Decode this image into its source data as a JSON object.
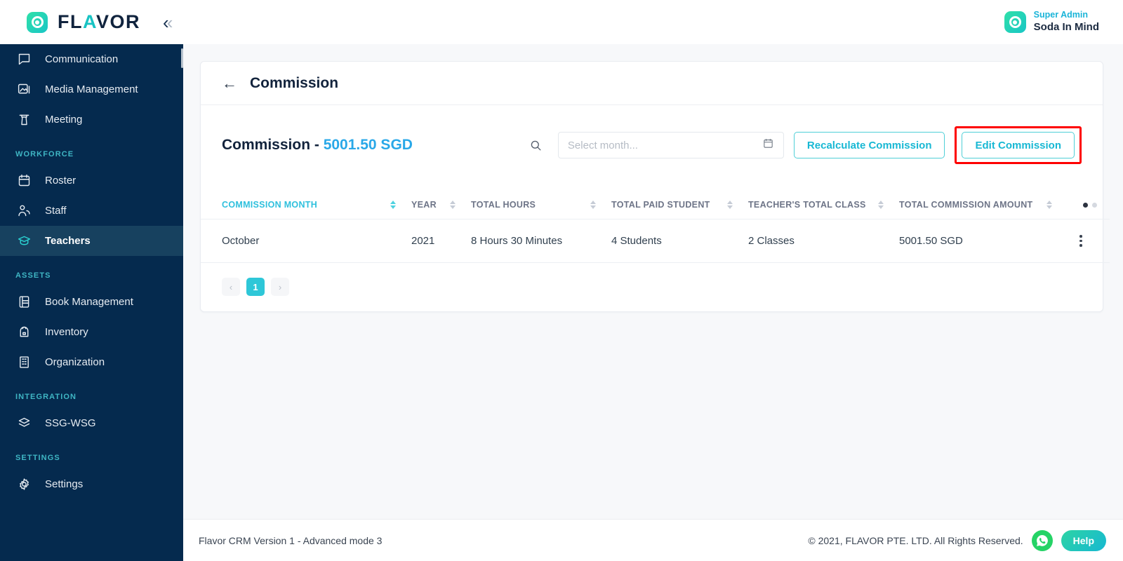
{
  "brand": {
    "name_prefix": "FL",
    "name_accent": "A",
    "name_suffix": "VOR",
    "full": "FLAVOR",
    "collapse_label": "«"
  },
  "user": {
    "role": "Super Admin",
    "name": "Soda In Mind"
  },
  "sidebar": {
    "items": [
      {
        "label": "Communication",
        "icon": "chat-icon",
        "active": false
      },
      {
        "label": "Media Management",
        "icon": "image-icon",
        "active": false
      },
      {
        "label": "Meeting",
        "icon": "podium-icon",
        "active": false
      }
    ],
    "groups": [
      {
        "title": "WORKFORCE",
        "items": [
          {
            "label": "Roster",
            "icon": "calendar-icon",
            "active": false
          },
          {
            "label": "Staff",
            "icon": "people-icon",
            "active": false
          },
          {
            "label": "Teachers",
            "icon": "graduation-cap-icon",
            "active": true
          }
        ]
      },
      {
        "title": "ASSETS",
        "items": [
          {
            "label": "Book Management",
            "icon": "book-icon",
            "active": false
          },
          {
            "label": "Inventory",
            "icon": "backpack-icon",
            "active": false
          },
          {
            "label": "Organization",
            "icon": "building-icon",
            "active": false
          }
        ]
      },
      {
        "title": "INTEGRATION",
        "items": [
          {
            "label": "SSG-WSG",
            "icon": "layers-icon",
            "active": false
          }
        ]
      },
      {
        "title": "SETTINGS",
        "items": [
          {
            "label": "Settings",
            "icon": "gear-icon",
            "active": false
          }
        ]
      }
    ]
  },
  "page": {
    "title": "Commission",
    "back_label": "←",
    "summary_label": "Commission - ",
    "summary_amount": "5001.50 SGD"
  },
  "toolbar": {
    "month_placeholder": "Select month...",
    "month_value": "",
    "recalculate_label": "Recalculate Commission",
    "edit_label": "Edit Commission"
  },
  "table": {
    "columns": [
      {
        "label": "COMMISSION MONTH",
        "sorted": true
      },
      {
        "label": "YEAR",
        "sorted": false
      },
      {
        "label": "TOTAL HOURS",
        "sorted": false
      },
      {
        "label": "TOTAL PAID STUDENT",
        "sorted": false
      },
      {
        "label": "TEACHER'S TOTAL CLASS",
        "sorted": false
      },
      {
        "label": "TOTAL COMMISSION AMOUNT",
        "sorted": false
      }
    ],
    "rows": [
      {
        "month": "October",
        "year": "2021",
        "total_hours": "8 Hours 30 Minutes",
        "total_paid_student": "4 Students",
        "teachers_total_class": "2 Classes",
        "total_commission_amount": "5001.50 SGD"
      }
    ]
  },
  "pagination": {
    "prev": "‹",
    "current": "1",
    "next": "›"
  },
  "footer": {
    "version": "Flavor CRM Version 1 - Advanced mode 3",
    "copyright": "© 2021, FLAVOR PTE. LTD. All Rights Reserved.",
    "help_label": "Help"
  },
  "colors": {
    "sidebar_bg": "#052a4e",
    "sidebar_active": "#17415f",
    "accent_teal": "#2ec7d8",
    "accent_blue": "#29a8e8",
    "group_label": "#3fb6c4",
    "highlight_red": "#fe0000",
    "whatsapp_green": "#25d366"
  }
}
